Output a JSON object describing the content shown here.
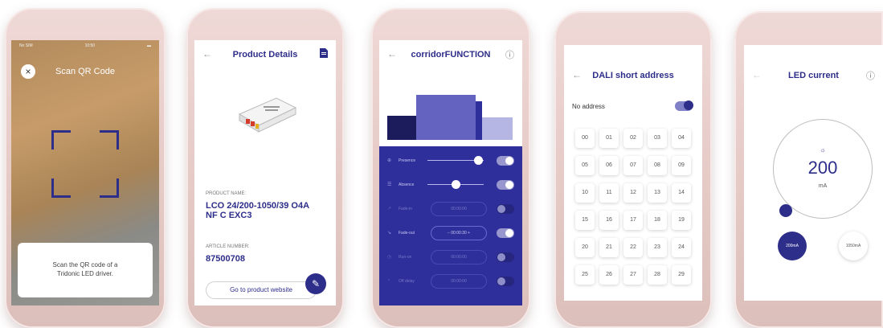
{
  "screen1": {
    "status_carrier": "No SIM",
    "status_time": "10:50",
    "title": "Scan QR Code",
    "close_glyph": "×",
    "instruction_line1": "Scan the QR code of a",
    "instruction_line2": "Tridonic LED driver."
  },
  "screen2": {
    "title": "Product Details",
    "back_glyph": "←",
    "product_name_label": "PRODUCT NAME:",
    "product_name_line1": "LCO 24/200-1050/39 O4A",
    "product_name_line2": "NF C EXC3",
    "article_number_label": "ARTICLE NUMBER:",
    "article_number": "87500708",
    "website_button": "Go to product website"
  },
  "screen3": {
    "title": "corridorFUNCTION",
    "back_glyph": "←",
    "info_glyph": "ⓘ",
    "rows": [
      {
        "label": "Presence",
        "value": "",
        "on": true,
        "slider": 0.85
      },
      {
        "label": "Absence",
        "value": "",
        "on": true,
        "slider": 0.45
      },
      {
        "label": "Fade-in",
        "value": "00:00:00",
        "on": false
      },
      {
        "label": "Fade-out",
        "value": "00:00:30",
        "on": true
      },
      {
        "label": "Run-on",
        "value": "00:00:00",
        "on": false
      },
      {
        "label": "Off delay",
        "value": "00:00:00",
        "on": false
      }
    ]
  },
  "screen4": {
    "title": "DALI short address",
    "back_glyph": "←",
    "no_address_label": "No address",
    "cells": [
      "00",
      "01",
      "02",
      "03",
      "04",
      "05",
      "06",
      "07",
      "08",
      "09",
      "10",
      "11",
      "12",
      "13",
      "14",
      "15",
      "16",
      "17",
      "18",
      "19",
      "20",
      "21",
      "22",
      "23",
      "24",
      "25",
      "26",
      "27",
      "28",
      "29"
    ]
  },
  "screen5": {
    "title": "LED current",
    "back_glyph": "←",
    "info_glyph": "ⓘ",
    "value": "200",
    "unit": "mA",
    "preset_low": "200mA",
    "preset_high": "1050mA"
  },
  "colors": {
    "accent": "#2d2d8a",
    "phone_frame": "#e6cbc7"
  }
}
